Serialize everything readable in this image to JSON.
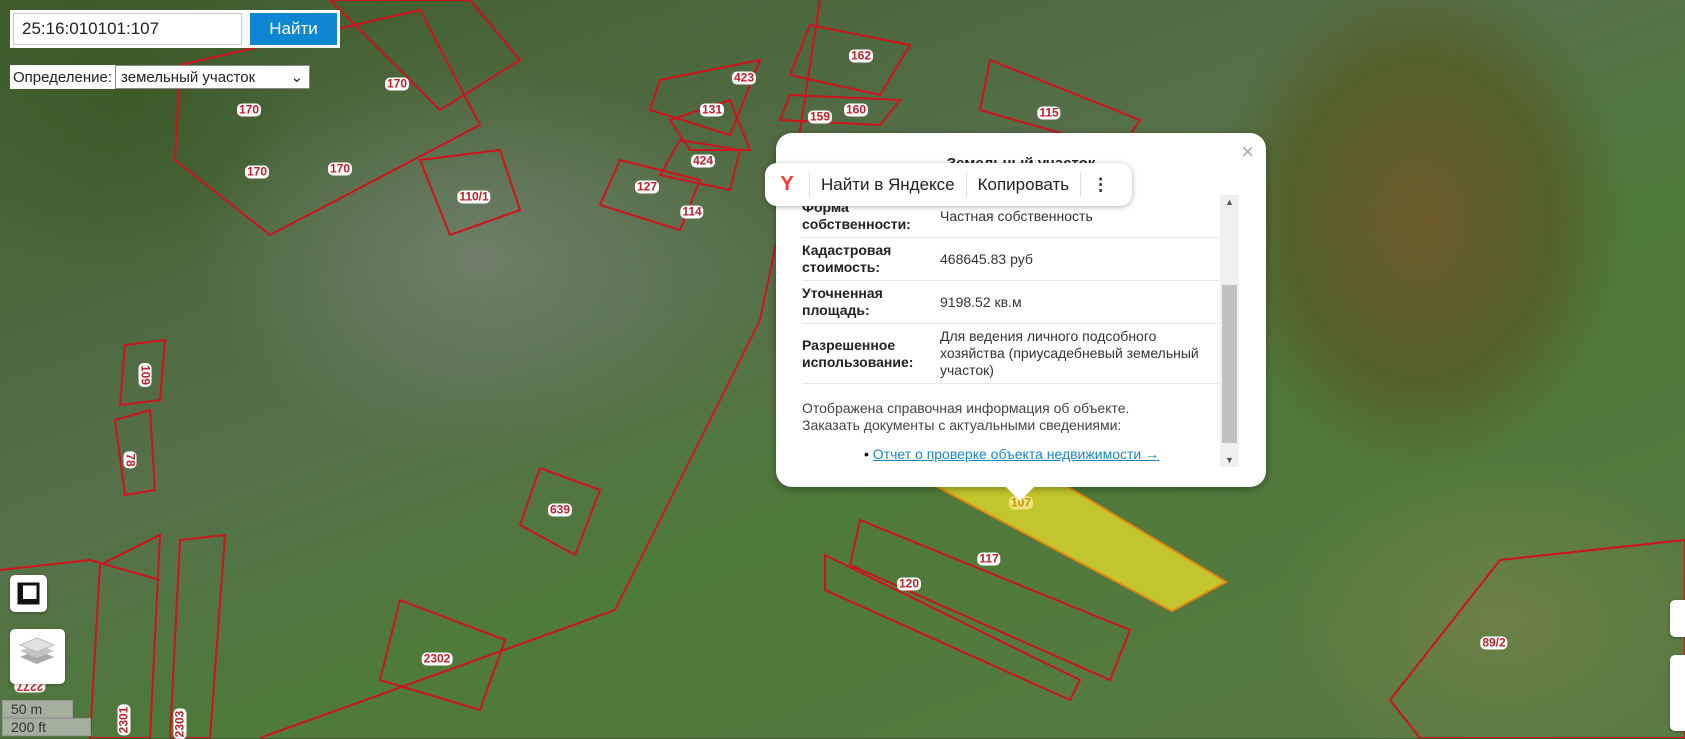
{
  "search": {
    "value": "25:16:010101:107",
    "button": "Найти"
  },
  "definition": {
    "label": "Определение:",
    "selected": "земельный участок"
  },
  "map": {
    "parcel_labels": [
      "170",
      "170",
      "170",
      "170",
      "110/1",
      "423",
      "162",
      "131",
      "159",
      "160",
      "424",
      "127",
      "114",
      "115",
      "109",
      "78",
      "639",
      "107",
      "117",
      "120",
      "2302",
      "2301",
      "2303",
      "89/2",
      "2277"
    ],
    "selected_parcel": "107",
    "selected_color": "#e8e02a",
    "border_color": "#d0121c"
  },
  "scale": {
    "metric": "50 m",
    "imperial": "200 ft"
  },
  "popup": {
    "title": "Земельный участок",
    "rows": [
      {
        "key": "Форма собственности",
        "value": "Частная собственность"
      },
      {
        "key": "Кадастровая стоимость",
        "value": "468645.83 руб"
      },
      {
        "key": "Уточненная площадь",
        "value": "9198.52 кв.м"
      },
      {
        "key": "Разрешенное использование",
        "value": "Для ведения личного подсобного хозяйства (приусадебневый земельный участок)"
      }
    ],
    "info_line1": "Отображена справочная информация об объекте.",
    "info_line2": "Заказать документы с актуальными сведениями:",
    "link": "Отчет о проверке объекта недвижимости →",
    "close": "×"
  },
  "yandex_toolbar": {
    "search": "Найти в Яндексе",
    "copy": "Копировать",
    "more": "⋮",
    "logo": "Y"
  }
}
